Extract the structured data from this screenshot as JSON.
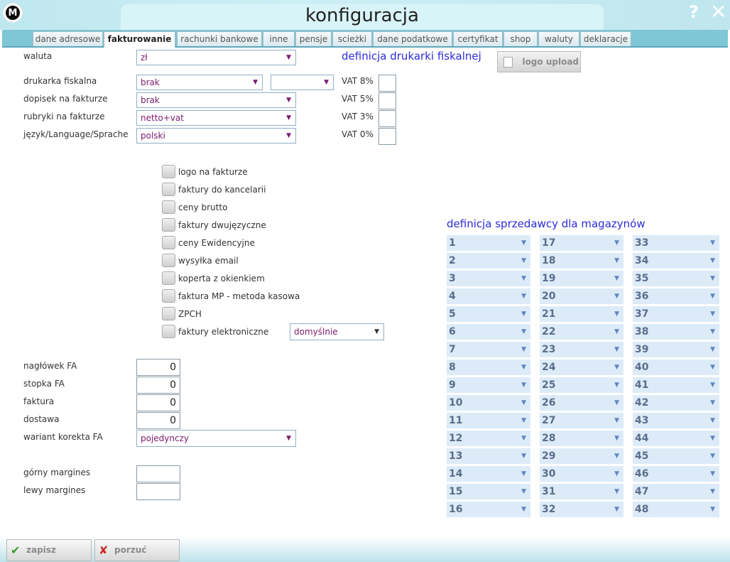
{
  "window": {
    "title": "konfiguracja",
    "logo_text": "M",
    "help_icon": "?",
    "close_icon": "✕"
  },
  "tabs": [
    {
      "label": "dane adresowe"
    },
    {
      "label": "fakturowanie",
      "active": true
    },
    {
      "label": "rachunki bankowe"
    },
    {
      "label": "inne"
    },
    {
      "label": "pensje"
    },
    {
      "label": "scieżki"
    },
    {
      "label": "dane podatkowe"
    },
    {
      "label": "certyfikat"
    },
    {
      "label": "shop"
    },
    {
      "label": "waluty"
    },
    {
      "label": "deklaracje"
    }
  ],
  "form": {
    "waluta": {
      "label": "waluta",
      "value": "zł"
    },
    "drukarka": {
      "label": "drukarka fiskalna",
      "value": "brak",
      "value2": ""
    },
    "dopisek": {
      "label": "dopisek na fakturze",
      "value": "brak"
    },
    "rubryki": {
      "label": "rubryki na fakturze",
      "value": "netto+vat"
    },
    "jezyk": {
      "label": "język/Language/Sprache",
      "value": "polski"
    }
  },
  "fiscal": {
    "heading": "definicja drukarki fiskalnej",
    "vat": [
      "VAT 8%",
      "VAT 5%",
      "VAT 3%",
      "VAT 0%"
    ],
    "logo_upload": "logo upload"
  },
  "checkboxes": [
    "logo na fakturze",
    "faktury do kancelarii",
    "ceny brutto",
    "faktury dwujęzyczne",
    "ceny Ewidencyjne",
    "wysyłka email",
    "koperta z okienkiem",
    "faktura MP - metoda kasowa",
    "ZPCH",
    "faktury elektroniczne"
  ],
  "efaktury_select": "domyślnie",
  "numbers": {
    "naglowek": {
      "label": "nagłówek FA",
      "value": "0"
    },
    "stopka": {
      "label": "stopka FA",
      "value": "0"
    },
    "faktura": {
      "label": "faktura",
      "value": "0"
    },
    "dostawa": {
      "label": "dostawa",
      "value": "0"
    },
    "wariant": {
      "label": "wariant korekta FA",
      "value": "pojedynczy"
    }
  },
  "margins": {
    "gorny": {
      "label": "górny margines",
      "value": ""
    },
    "lewy": {
      "label": "lewy margines",
      "value": ""
    }
  },
  "warehouses": {
    "heading": "definicja sprzedawcy dla magazynów",
    "col1": [
      "1",
      "2",
      "3",
      "4",
      "5",
      "6",
      "7",
      "8",
      "9",
      "10",
      "11",
      "12",
      "13",
      "14",
      "15",
      "16"
    ],
    "col2": [
      "17",
      "18",
      "19",
      "20",
      "21",
      "22",
      "23",
      "24",
      "25",
      "26",
      "27",
      "28",
      "29",
      "30",
      "31",
      "32"
    ],
    "col3": [
      "33",
      "34",
      "35",
      "36",
      "37",
      "38",
      "39",
      "40",
      "41",
      "42",
      "43",
      "44",
      "45",
      "46",
      "47",
      "48"
    ]
  },
  "buttons": {
    "save": "zapisz",
    "cancel": "porzuć"
  },
  "colors": {
    "accent_blue": "#2b2bd9",
    "select_text": "#7b1a6e",
    "tab_bar": "#7fc6d6"
  }
}
